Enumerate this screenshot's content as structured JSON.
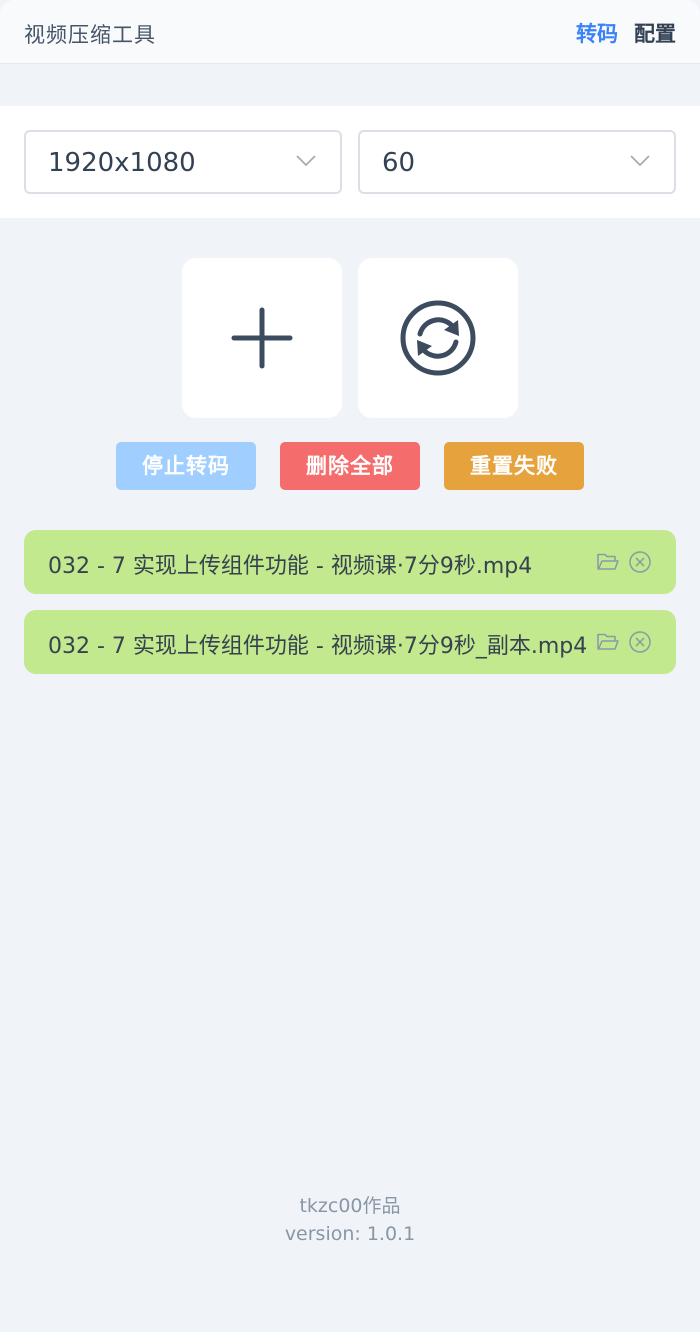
{
  "header": {
    "title": "视频压缩工具",
    "nav": [
      "转码",
      "配置"
    ],
    "active_nav": "转码"
  },
  "settings": {
    "resolution": "1920x1080",
    "fps": "60"
  },
  "big_buttons": {
    "add_icon": "plus-icon",
    "refresh_icon": "refresh-icon"
  },
  "actions": {
    "stop": "停止转码",
    "delete_all": "删除全部",
    "reset_failed": "重置失败"
  },
  "files": [
    {
      "name": "032 - 7 实现上传组件功能 - 视频课·7分9秒.mp4",
      "icons": [
        "folder-open-icon",
        "close-circle-icon"
      ]
    },
    {
      "name": "032 - 7 实现上传组件功能 - 视频课·7分9秒_副本.mp4",
      "icons": [
        "folder-open-icon",
        "close-circle-icon"
      ]
    }
  ],
  "footer": {
    "author": "tkzc00作品",
    "version": "version: 1.0.1"
  },
  "colors": {
    "accent": "#3b82f6",
    "stop": "#a0cfff",
    "delete": "#f56c6c",
    "reset": "#e6a23c",
    "file_bg": "#c2e98d"
  }
}
